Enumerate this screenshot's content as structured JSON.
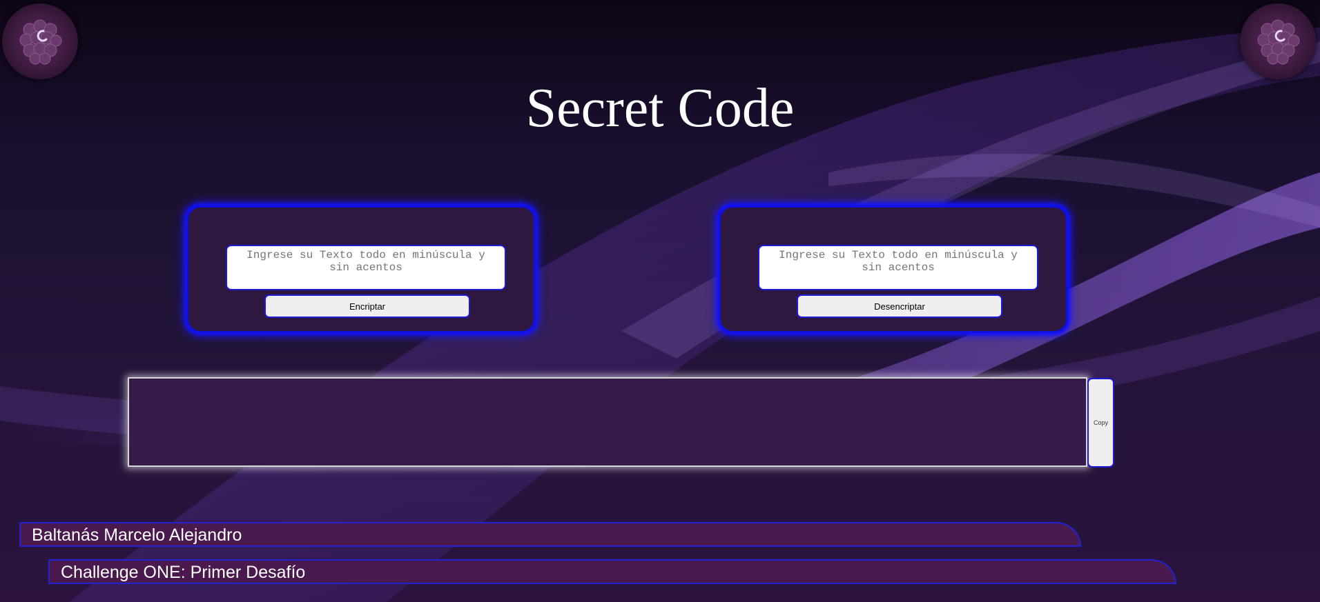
{
  "page": {
    "title": "Secret Code"
  },
  "logos": {
    "left": "logo-badge",
    "right": "logo-badge"
  },
  "encrypt_panel": {
    "input_placeholder": "Ingrese su Texto todo en minúscula y sin acentos",
    "input_value": "",
    "button_label": "Encriptar"
  },
  "decrypt_panel": {
    "input_placeholder": "Ingrese su Texto todo en minúscula y sin acentos",
    "input_value": "",
    "button_label": "Desencriptar"
  },
  "output": {
    "value": "",
    "copy_label": "Copy"
  },
  "footer": {
    "author": "Baltanás Marcelo Alejandro",
    "challenge": "Challenge ONE: Primer Desafío"
  },
  "colors": {
    "accent_blue": "#1010e0",
    "panel_bg": "#2f1840",
    "footer_bg": "#4a1a4f"
  }
}
